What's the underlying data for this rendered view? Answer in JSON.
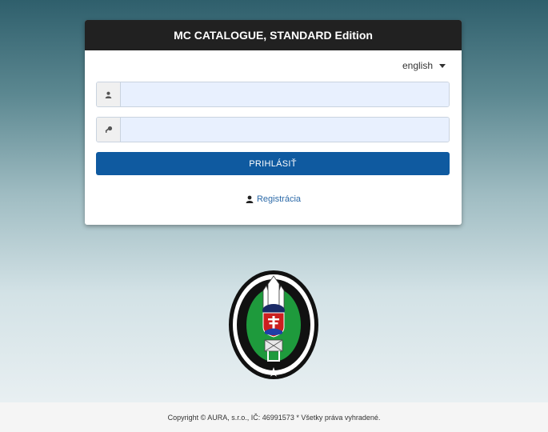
{
  "header": {
    "title": "MC CATALOGUE, STANDARD Edition"
  },
  "language": {
    "selected": "english"
  },
  "form": {
    "username_value": "",
    "password_value": "",
    "login_label": "PRIHLÁSIŤ"
  },
  "register": {
    "label": "Registrácia"
  },
  "footer": {
    "text": "Copyright © AURA, s.r.o., IČ: 46991573 * Všetky práva vyhradené."
  },
  "icons": {
    "user": "user-icon",
    "key": "key-icon",
    "caret": "caret-down-icon"
  },
  "colors": {
    "header_bg": "#212121",
    "button_bg": "#0f5aa0",
    "link": "#2c6aa8",
    "input_bg": "#e8f0fe"
  }
}
